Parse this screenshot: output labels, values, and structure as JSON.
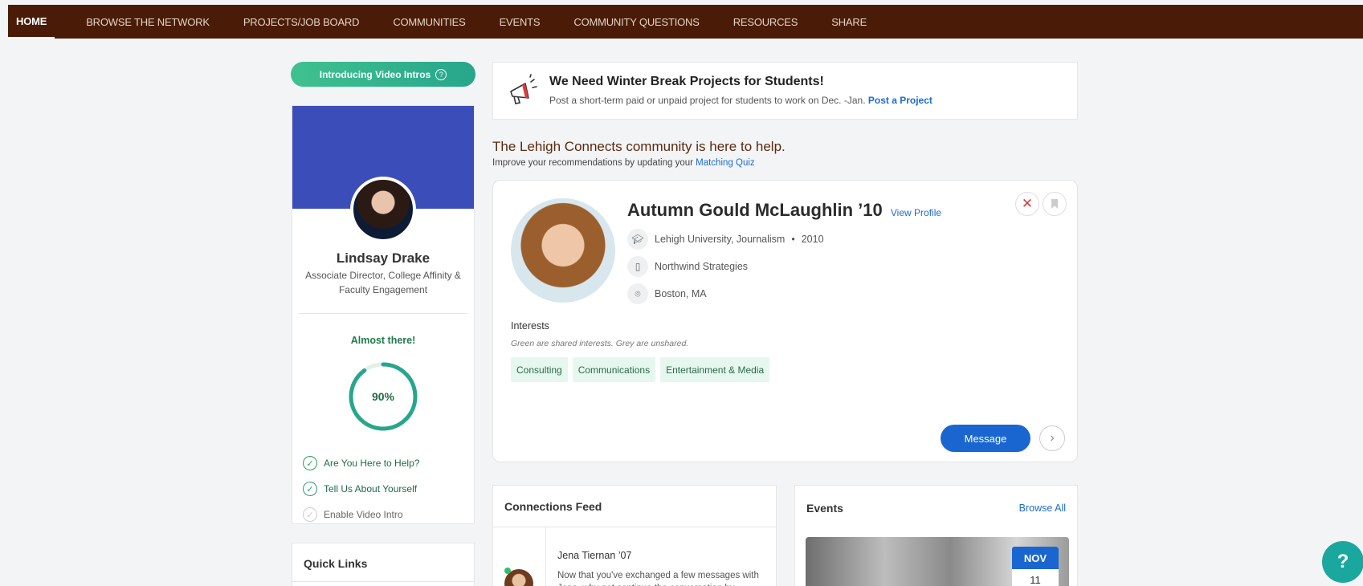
{
  "nav": {
    "items": [
      "HOME",
      "BROWSE THE NETWORK",
      "PROJECTS/JOB BOARD",
      "COMMUNITIES",
      "EVENTS",
      "COMMUNITY QUESTIONS",
      "RESOURCES",
      "SHARE"
    ],
    "active": "HOME",
    "background": "#4a1c07"
  },
  "intro_pill": {
    "label": "Introducing Video Intros",
    "help_glyph": "?"
  },
  "profile": {
    "name": "Lindsay Drake",
    "title": "Associate Director, College Affinity & Faculty Engagement",
    "status": "Almost there!",
    "progress_label": "90%",
    "progress_fraction": 0.9,
    "checklist": [
      {
        "label": "Are You Here to Help?",
        "done": true
      },
      {
        "label": "Tell Us About Yourself",
        "done": true
      },
      {
        "label": "Enable Video Intro",
        "done": false
      }
    ]
  },
  "quick_links": {
    "title": "Quick Links"
  },
  "banner": {
    "title": "We Need Winter Break Projects for Students!",
    "subtitle": "Post a short-term paid or unpaid project for students to work on Dec. -Jan.",
    "link": "Post a Project",
    "icon": "megaphone-icon"
  },
  "help": {
    "heading": "The Lehigh Connects community is here to help.",
    "sub": "Improve your recommendations by updating your",
    "sub_link": "Matching Quiz"
  },
  "match": {
    "name": "Autumn Gould McLaughlin ’10",
    "view_profile": "View Profile",
    "education": "Lehigh University, Journalism",
    "year_sep": "•",
    "year": "2010",
    "company": "Northwind Strategies",
    "location": "Boston, MA",
    "interests_label": "Interests",
    "interests_note": "Green are shared interests. Grey are unshared.",
    "interests": [
      "Consulting",
      "Communications",
      "Entertainment & Media"
    ],
    "message_label": "Message",
    "close_glyph": "✕",
    "next_glyph": "›"
  },
  "feed": {
    "title": "Connections Feed",
    "item_name": "Jena Tiernan ’07",
    "item_text": "Now that you've exchanged a few messages with Jena, why not continue the conversation by"
  },
  "events": {
    "title": "Events",
    "browse": "Browse All",
    "month": "NOV",
    "day": "11"
  },
  "help_fab": "?"
}
